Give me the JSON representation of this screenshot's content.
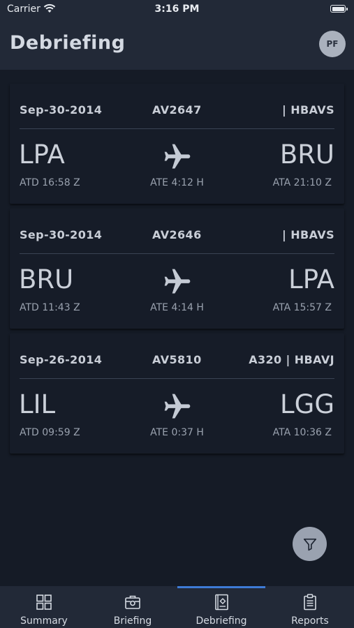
{
  "status_bar": {
    "carrier": "Carrier",
    "time": "3:16 PM"
  },
  "header": {
    "title": "Debriefing",
    "avatar_initials": "PF"
  },
  "flights": [
    {
      "date": "Sep-30-2014",
      "flight_number": "AV2647",
      "registration": "|  HBAVS",
      "origin": "LPA",
      "destination": "BRU",
      "atd": "ATD 16:58 Z",
      "ate": "ATE 4:12 H",
      "ata": "ATA 21:10 Z"
    },
    {
      "date": "Sep-30-2014",
      "flight_number": "AV2646",
      "registration": "|  HBAVS",
      "origin": "BRU",
      "destination": "LPA",
      "atd": "ATD 11:43 Z",
      "ate": "ATE 4:14 H",
      "ata": "ATA 15:57 Z"
    },
    {
      "date": "Sep-26-2014",
      "flight_number": "AV5810",
      "registration": "A320  |  HBAVJ",
      "origin": "LIL",
      "destination": "LGG",
      "atd": "ATD 09:59 Z",
      "ate": "ATE 0:37 H",
      "ata": "ATA 10:36 Z"
    }
  ],
  "filter": {
    "icon": "filter-icon"
  },
  "tabs": [
    {
      "label": "Summary",
      "icon": "grid-icon",
      "active": false
    },
    {
      "label": "Briefing",
      "icon": "briefcase-icon",
      "active": false
    },
    {
      "label": "Debriefing",
      "icon": "book-icon",
      "active": true
    },
    {
      "label": "Reports",
      "icon": "clipboard-icon",
      "active": false
    }
  ],
  "colors": {
    "background": "#151b26",
    "bar": "#222937",
    "active_tab_indicator": "#3e7bd6"
  }
}
